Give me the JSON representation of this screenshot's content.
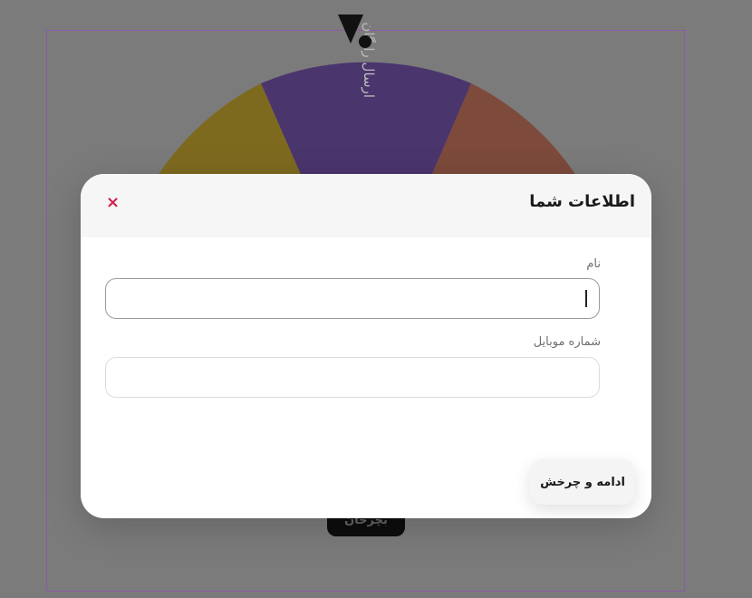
{
  "background": {
    "wheel": {
      "segments": [
        {
          "color": "#4b356d",
          "label": "ارسال رایگان"
        },
        {
          "color": "#7d4a3b",
          "label": ""
        },
        {
          "color": "#7e6a1f",
          "label": ""
        }
      ]
    },
    "spin_button_label": "بچرخان"
  },
  "modal": {
    "title": "اطلاعات شما",
    "close_icon": "×",
    "fields": [
      {
        "label": "نام",
        "value": "",
        "placeholder": ""
      },
      {
        "label": "شماره موبایل",
        "value": "",
        "placeholder": ""
      }
    ],
    "submit_label": "ادامه و چرخش"
  },
  "colors": {
    "close": "#d21f4a",
    "frame": "#8c5aa6"
  }
}
